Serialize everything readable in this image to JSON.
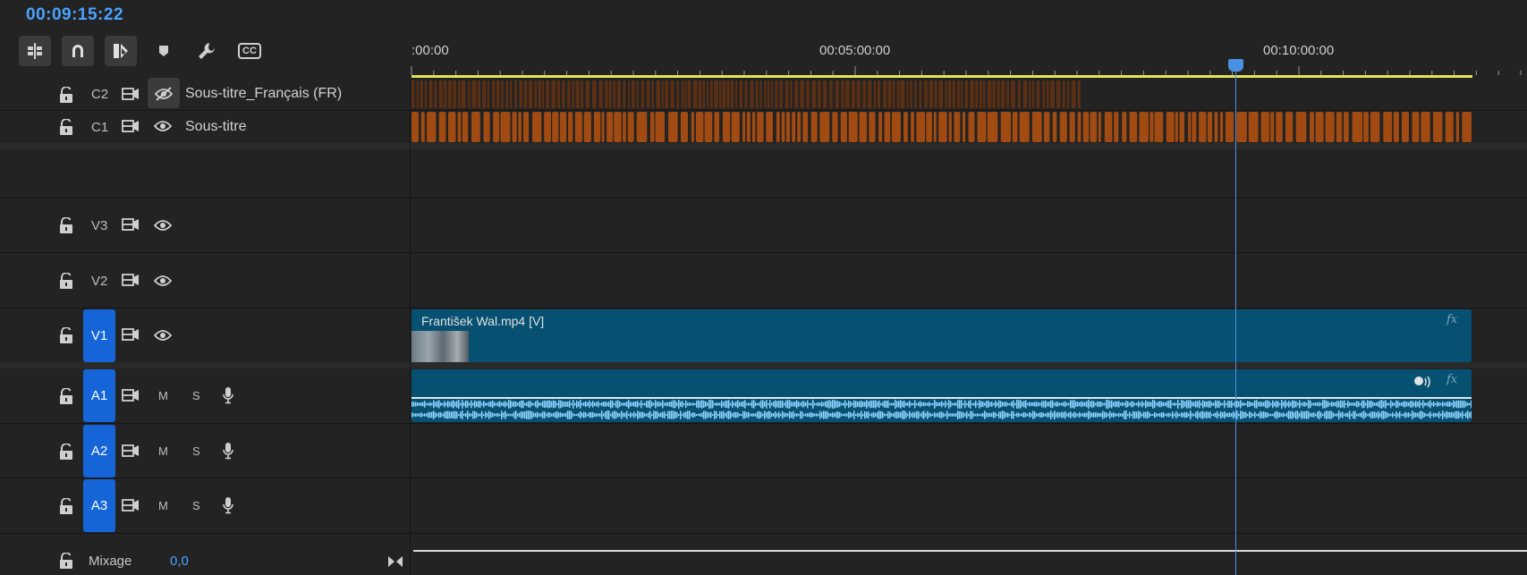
{
  "timecode": "00:09:15:22",
  "toolbar": {
    "tools": [
      "insert-sequence-icon",
      "snap-magnet-icon",
      "linked-selection-icon",
      "marker-icon",
      "wrench-icon",
      "captions-icon"
    ],
    "captions_label": "CC"
  },
  "ruler": {
    "labels": [
      ":00:00",
      "00:05:00:00",
      "00:10:00:00"
    ]
  },
  "tracks": {
    "c2": {
      "name": "C2",
      "label": "Sous-titre_Français (FR)",
      "visible": false
    },
    "c1": {
      "name": "C1",
      "label": "Sous-titre",
      "visible": true
    },
    "v3": {
      "name": "V3"
    },
    "v2": {
      "name": "V2"
    },
    "v1": {
      "name": "V1",
      "selected": true
    },
    "a1": {
      "name": "A1",
      "selected": true,
      "mute": "M",
      "solo": "S"
    },
    "a2": {
      "name": "A2",
      "selected": true,
      "mute": "M",
      "solo": "S"
    },
    "a3": {
      "name": "A3",
      "selected": true,
      "mute": "M",
      "solo": "S"
    },
    "mix": {
      "label": "Mixage",
      "value": "0,0"
    }
  },
  "clips": {
    "video": {
      "name": "František Wal.mp4 [V]",
      "fx": "fx"
    },
    "audio": {
      "fx": "fx"
    }
  },
  "colors": {
    "accent": "#4aa3ff",
    "track_selected": "#1565d8",
    "clip": "#065071",
    "caption_clip": "#a14a12",
    "work_area": "#e6e35a"
  }
}
